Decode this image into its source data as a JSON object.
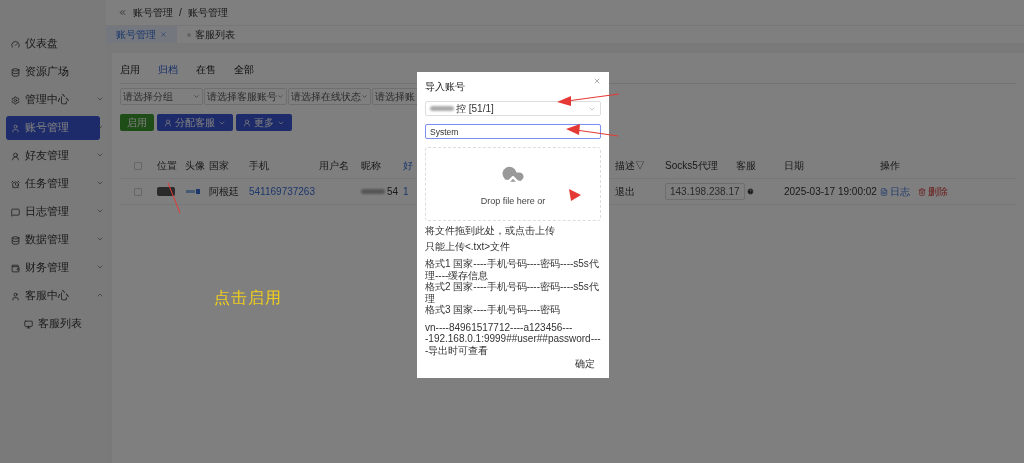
{
  "breadcrumb": [
    "账号管理",
    "账号管理"
  ],
  "breadcrumb_separator": "/",
  "page_tabs": [
    {
      "label": "账号管理",
      "selected": true,
      "closable": true
    },
    {
      "label": "客服列表",
      "selected": false,
      "closable": false
    }
  ],
  "sidebar": {
    "items": [
      {
        "label": "仪表盘",
        "selected": false
      },
      {
        "label": "资源广场",
        "selected": false
      },
      {
        "label": "管理中心",
        "selected": false,
        "expanded": false
      },
      {
        "label": "账号管理",
        "selected": true,
        "expanded": false
      },
      {
        "label": "好友管理",
        "selected": false,
        "expanded": false
      },
      {
        "label": "任务管理",
        "selected": false,
        "expanded": false
      },
      {
        "label": "日志管理",
        "selected": false,
        "expanded": false
      },
      {
        "label": "数据管理",
        "selected": false,
        "expanded": false
      },
      {
        "label": "财务管理",
        "selected": false,
        "expanded": false
      },
      {
        "label": "客服中心",
        "selected": false,
        "expanded": true,
        "children": [
          {
            "label": "客服列表",
            "selected": false
          }
        ]
      }
    ]
  },
  "status_tabs": [
    {
      "label": "启用",
      "selected": false
    },
    {
      "label": "归档",
      "selected": true
    },
    {
      "label": "在售",
      "selected": false
    },
    {
      "label": "全部",
      "selected": false
    }
  ],
  "filters": [
    {
      "placeholder": "请选择分组"
    },
    {
      "placeholder": "请选择客服账号"
    },
    {
      "placeholder": "请选择在线状态"
    },
    {
      "placeholder": "请选择账"
    }
  ],
  "actions": [
    {
      "label": "启用",
      "kind": "plain"
    },
    {
      "label": "分配客服",
      "kind": "menu"
    },
    {
      "label": "更多",
      "kind": "menu"
    }
  ],
  "table": {
    "all_checked": false,
    "columns_left": [
      "位置",
      "头像",
      "国家",
      "手机",
      "用户名",
      "昵称",
      "好"
    ],
    "columns_right": [
      "描述▽",
      "Socks5代理",
      "客服",
      "日期",
      "操作"
    ],
    "rows": [
      {
        "checked": false,
        "country": "阿根廷",
        "phone": "541169737263",
        "nickname": "54",
        "friends": "1",
        "description": "退出",
        "proxy": "143.198.238.17",
        "date": "2025-03-17 19:00:02",
        "log": "日志",
        "delete": "删除"
      }
    ]
  },
  "dialog": {
    "title": "导入账号",
    "account": "控 [51/1]",
    "input": "System",
    "drop_text": "Drop file here or",
    "hint": "将文件拖到此处，或点击上传",
    "notes": [
      "只能上传<.txt>文件"
    ],
    "formats": [
      "格式1 国家----手机号码----密码----s5s代理----缓存信息",
      "格式2 国家----手机号码----密码----s5s代理",
      "格式3 国家----手机号码----密码"
    ],
    "example": [
      "vn----84961517712----a123456---",
      "-192.168.0.1:9999##user##password----导出时可查看"
    ],
    "confirm": "确定"
  },
  "annotation": {
    "label": "点击启用"
  }
}
